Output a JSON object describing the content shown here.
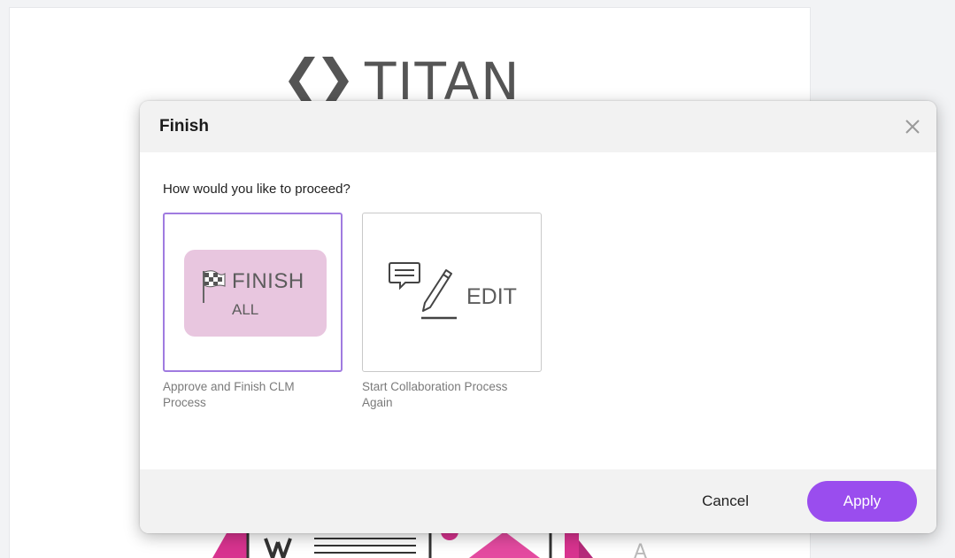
{
  "background": {
    "logo_text": "TITAN"
  },
  "modal": {
    "title": "Finish",
    "question": "How would you like to proceed?",
    "options": [
      {
        "tile_title": "FINISH",
        "tile_subtitle": "ALL",
        "caption": "Approve and Finish CLM Process",
        "selected": true
      },
      {
        "tile_title": "EDIT",
        "caption": "Start Collaboration Process Again",
        "selected": false
      }
    ],
    "footer": {
      "cancel_label": "Cancel",
      "apply_label": "Apply"
    }
  },
  "colors": {
    "accent": "#9a4dee",
    "selected_border": "#a07be0",
    "finish_tile": "#e8c6df"
  },
  "icons": {
    "close": "close-icon",
    "flag": "checkered-flag-icon",
    "chat": "chat-bubble-icon",
    "pencil": "pencil-icon"
  }
}
